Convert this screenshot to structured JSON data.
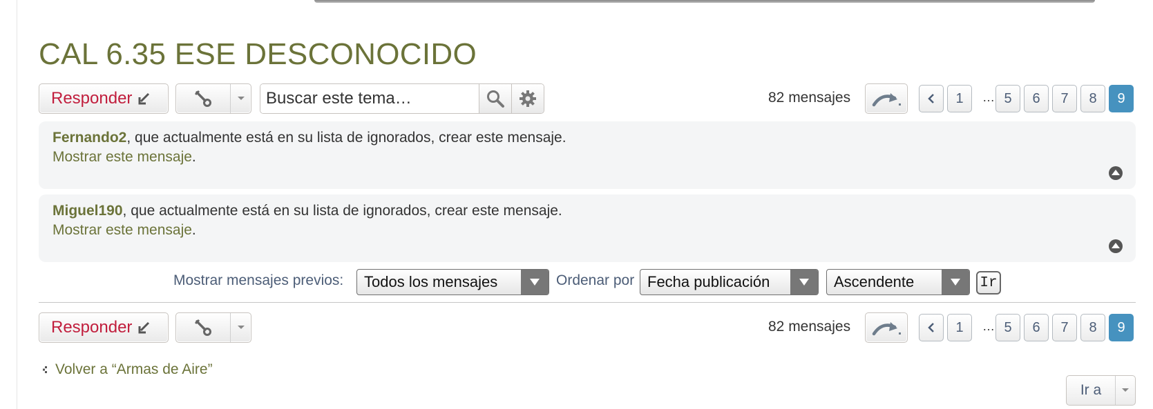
{
  "topic": {
    "title": "CAL 6.35 ESE DESCONOCIDO"
  },
  "actions": {
    "reply_label": "Responder",
    "search_placeholder": "Buscar este tema…",
    "post_count": "82 mensajes"
  },
  "pagination": {
    "pages": [
      "1",
      "5",
      "6",
      "7",
      "8",
      "9"
    ],
    "ellipsis": "…",
    "current": "9"
  },
  "ignored_posts": [
    {
      "author": "Fernando2",
      "message": ", que actualmente está en su lista de ignorados, crear este mensaje.",
      "show_link": "Mostrar este mensaje",
      "show_suffix": "."
    },
    {
      "author": "Miguel190",
      "message": ", que actualmente está en su lista de ignorados, crear este mensaje.",
      "show_link": "Mostrar este mensaje",
      "show_suffix": "."
    }
  ],
  "sort": {
    "display_label": "Mostrar mensajes previos:",
    "display_value": "Todos los mensajes",
    "order_label": "Ordenar por",
    "order_value": "Fecha publicación",
    "direction_value": "Ascendente",
    "go_label": "Ir"
  },
  "footer": {
    "back_link": "Volver a “Armas de Aire”",
    "jump_label": "Ir a"
  },
  "colors": {
    "title": "#6b7339",
    "reply": "#c11e3d",
    "active_page": "#4692bf",
    "link": "#6b7339"
  }
}
